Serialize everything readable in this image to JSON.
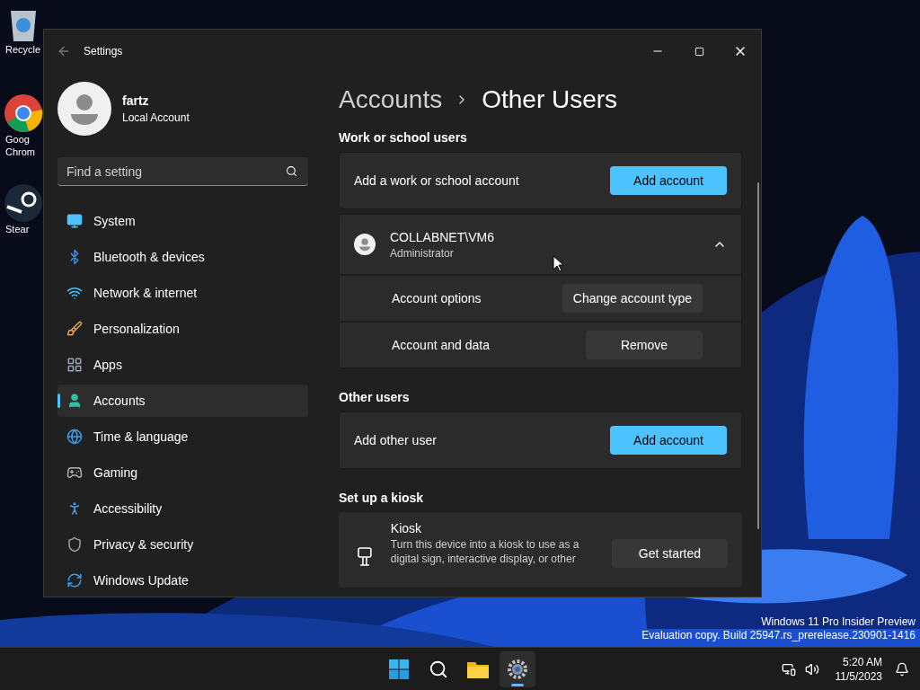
{
  "desktop": {
    "icons": [
      {
        "kind": "recycle",
        "lines": [
          "Recycle"
        ]
      },
      {
        "kind": "chrome",
        "lines": [
          "Goog",
          "Chrom"
        ]
      },
      {
        "kind": "steam",
        "lines": [
          "Stear"
        ]
      }
    ],
    "notice": [
      "Windows 11 Pro Insider Preview",
      "Evaluation copy. Build 25947.rs_prerelease.230901-1416"
    ]
  },
  "window": {
    "title": "Settings",
    "user": {
      "name": "fartz",
      "account_type": "Local Account"
    },
    "search": {
      "placeholder": "Find a setting"
    },
    "nav": [
      {
        "kind": "system",
        "label": "System",
        "selected": false
      },
      {
        "kind": "bluetooth",
        "label": "Bluetooth & devices",
        "selected": false
      },
      {
        "kind": "network",
        "label": "Network & internet",
        "selected": false
      },
      {
        "kind": "personalization",
        "label": "Personalization",
        "selected": false
      },
      {
        "kind": "apps",
        "label": "Apps",
        "selected": false
      },
      {
        "kind": "accounts",
        "label": "Accounts",
        "selected": true
      },
      {
        "kind": "time",
        "label": "Time & language",
        "selected": false
      },
      {
        "kind": "gaming",
        "label": "Gaming",
        "selected": false
      },
      {
        "kind": "accessibility",
        "label": "Accessibility",
        "selected": false
      },
      {
        "kind": "privacy",
        "label": "Privacy & security",
        "selected": false
      },
      {
        "kind": "update",
        "label": "Windows Update",
        "selected": false
      }
    ],
    "breadcrumb": {
      "parent": "Accounts",
      "current": "Other Users"
    },
    "sections": [
      {
        "title": "Work or school users",
        "cards": [
          {
            "kind": "action",
            "label": "Add a work or school account",
            "button": "Add account"
          },
          {
            "kind": "account",
            "name": "COLLABNET\\VM6",
            "role": "Administrator",
            "expanded": true,
            "options": [
              {
                "label": "Account options",
                "button": "Change account type"
              },
              {
                "label": "Account and data",
                "button": "Remove"
              }
            ]
          }
        ]
      },
      {
        "title": "Other users",
        "cards": [
          {
            "kind": "action",
            "label": "Add other user",
            "button": "Add account"
          }
        ]
      },
      {
        "title": "Set up a kiosk",
        "cards": [
          {
            "kind": "kiosk",
            "label": "Kiosk",
            "description": "Turn this device into a kiosk to use as a digital sign, interactive display, or other",
            "button": "Get started"
          }
        ]
      }
    ]
  },
  "taskbar": {
    "apps": [
      {
        "kind": "start",
        "active": false
      },
      {
        "kind": "search",
        "active": false
      },
      {
        "kind": "explorer",
        "active": false
      },
      {
        "kind": "settings",
        "active": true
      }
    ],
    "time": "5:20 AM",
    "date": "11/5/2023"
  }
}
